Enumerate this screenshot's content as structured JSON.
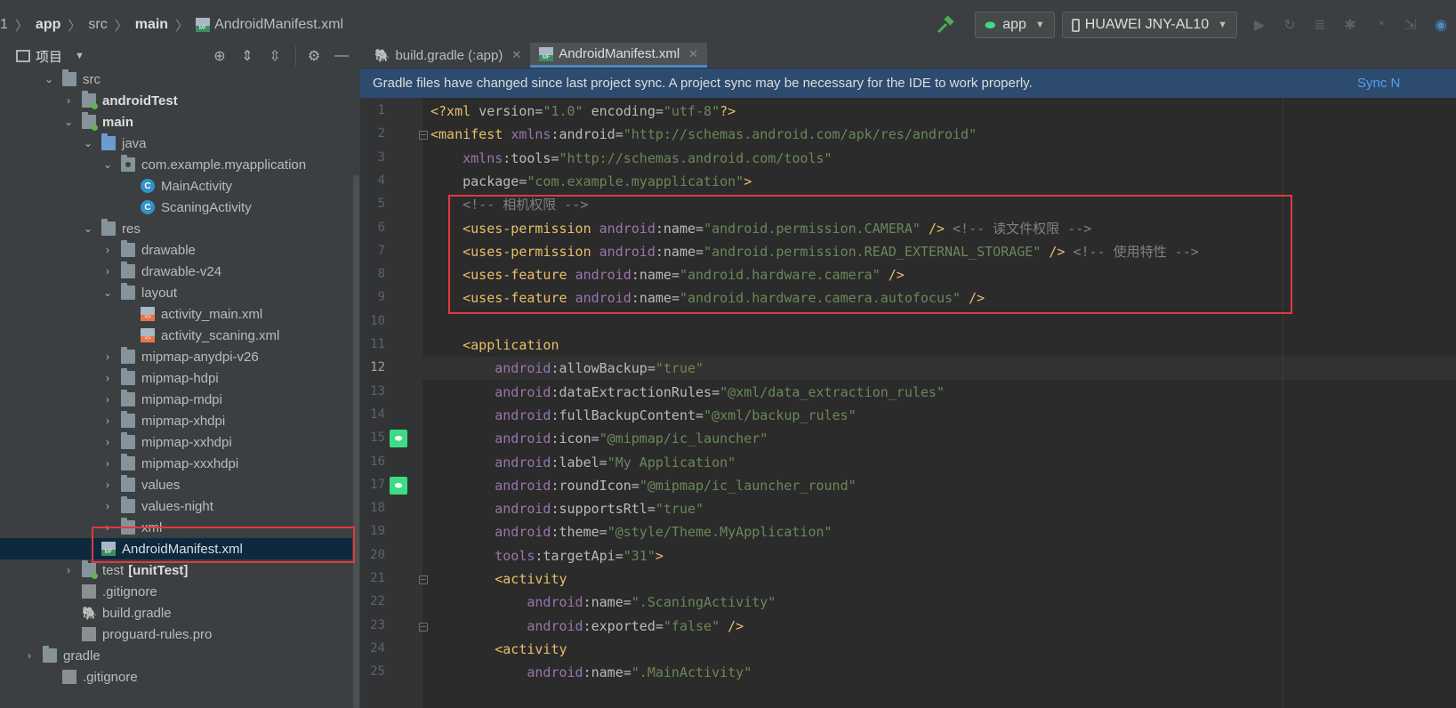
{
  "breadcrumb": {
    "items": [
      "1",
      "app",
      "src",
      "main",
      "AndroidManifest.xml"
    ]
  },
  "toolbar": {
    "config_label": "app",
    "device_label": "HUAWEI JNY-AL10"
  },
  "project_panel": {
    "title": "项目",
    "tree": [
      {
        "label": "src"
      },
      {
        "label": "androidTest"
      },
      {
        "label": "main"
      },
      {
        "label": "java"
      },
      {
        "label": "com.example.myapplication"
      },
      {
        "label": "MainActivity"
      },
      {
        "label": "ScaningActivity"
      },
      {
        "label": "res"
      },
      {
        "label": "drawable"
      },
      {
        "label": "drawable-v24"
      },
      {
        "label": "layout"
      },
      {
        "label": "activity_main.xml"
      },
      {
        "label": "activity_scaning.xml"
      },
      {
        "label": "mipmap-anydpi-v26"
      },
      {
        "label": "mipmap-hdpi"
      },
      {
        "label": "mipmap-mdpi"
      },
      {
        "label": "mipmap-xhdpi"
      },
      {
        "label": "mipmap-xxhdpi"
      },
      {
        "label": "mipmap-xxxhdpi"
      },
      {
        "label": "values"
      },
      {
        "label": "values-night"
      },
      {
        "label": "xml"
      },
      {
        "label": "AndroidManifest.xml"
      },
      {
        "label": "test",
        "suffix": "[unitTest]"
      },
      {
        "label": ".gitignore"
      },
      {
        "label": "build.gradle"
      },
      {
        "label": "proguard-rules.pro"
      },
      {
        "label": "gradle"
      },
      {
        "label": ".gitignore"
      }
    ]
  },
  "tabs": [
    {
      "label": "build.gradle (:app)"
    },
    {
      "label": "AndroidManifest.xml"
    }
  ],
  "banner": {
    "message": "Gradle files have changed since last project sync. A project sync may be necessary for the IDE to work properly.",
    "action": "Sync N"
  },
  "editor": {
    "line_numbers": [
      "1",
      "2",
      "3",
      "4",
      "5",
      "6",
      "7",
      "8",
      "9",
      "10",
      "11",
      "12",
      "13",
      "14",
      "15",
      "16",
      "17",
      "18",
      "19",
      "20",
      "21",
      "22",
      "23",
      "24",
      "25"
    ],
    "current_line": "12",
    "lines": [
      "<?xml version=\"1.0\" encoding=\"utf-8\"?>",
      "<manifest xmlns:android=\"http://schemas.android.com/apk/res/android\"",
      "    xmlns:tools=\"http://schemas.android.com/tools\"",
      "    package=\"com.example.myapplication\">",
      "    <!-- 相机权限 -->",
      "    <uses-permission android:name=\"android.permission.CAMERA\" /> <!-- 读文件权限 -->",
      "    <uses-permission android:name=\"android.permission.READ_EXTERNAL_STORAGE\" /> <!-- 使用特性 -->",
      "    <uses-feature android:name=\"android.hardware.camera\" />",
      "    <uses-feature android:name=\"android.hardware.camera.autofocus\" />",
      "",
      "    <application",
      "        android:allowBackup=\"true\"",
      "        android:dataExtractionRules=\"@xml/data_extraction_rules\"",
      "        android:fullBackupContent=\"@xml/backup_rules\"",
      "        android:icon=\"@mipmap/ic_launcher\"",
      "        android:label=\"My Application\"",
      "        android:roundIcon=\"@mipmap/ic_launcher_round\"",
      "        android:supportsRtl=\"true\"",
      "        android:theme=\"@style/Theme.MyApplication\"",
      "        tools:targetApi=\"31\">",
      "        <activity",
      "            android:name=\".ScaningActivity\"",
      "            android:exported=\"false\" />",
      "        <activity",
      "            android:name=\".MainActivity\""
    ]
  },
  "colors": {
    "tag": "#e8bf6a",
    "namespace": "#9876aa",
    "value": "#6a8759",
    "comment": "#808080",
    "highlight_box": "#e0393e",
    "banner_bg": "#2c4b6e"
  },
  "icons": [
    "hammer-icon",
    "android-icon",
    "phone-icon",
    "run-icon",
    "apply-changes-icon",
    "coverage-icon",
    "debug-icon",
    "profile-icon",
    "attach-icon",
    "globe-icon",
    "expand-all-icon",
    "collapse-all-icon",
    "gear-icon",
    "minimize-icon",
    "close-icon"
  ]
}
